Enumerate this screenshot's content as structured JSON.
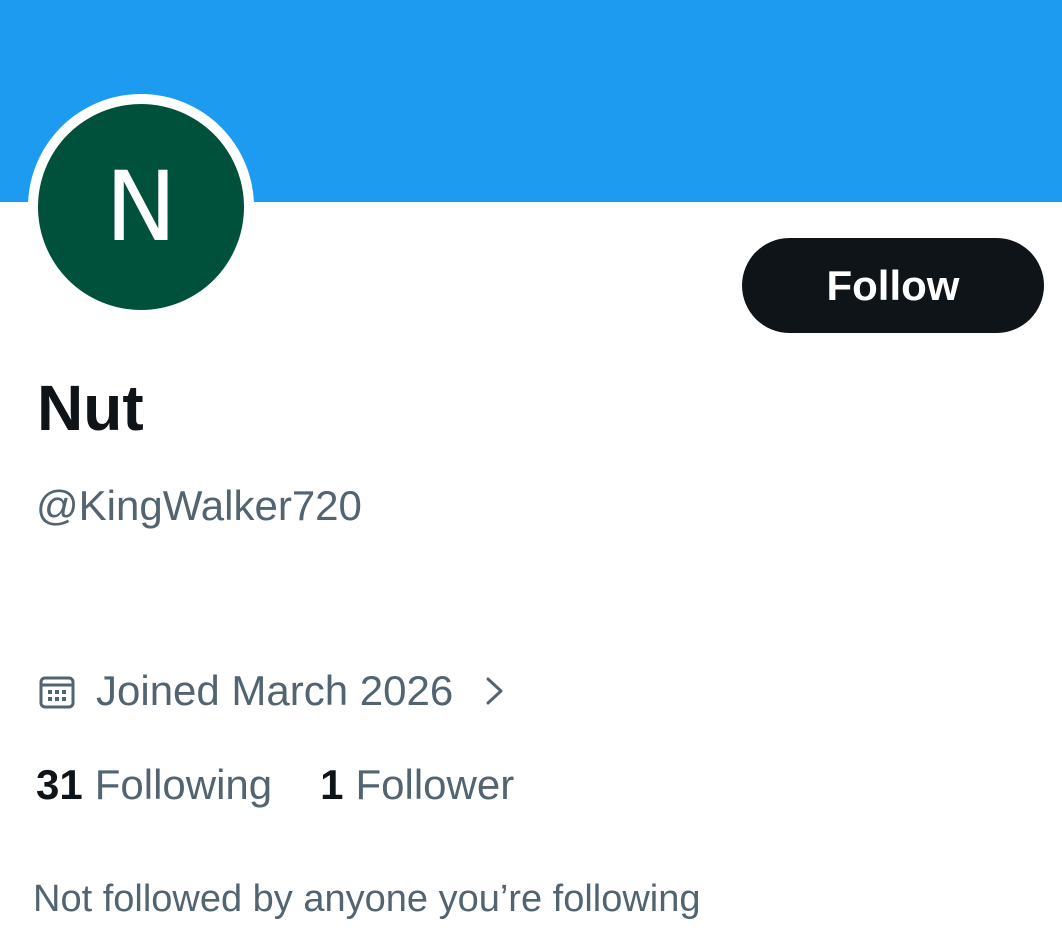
{
  "colors": {
    "banner": "#1d9bf0",
    "avatar_bg": "#00513b",
    "follow_bg": "#0f1419",
    "text_primary": "#0f1419",
    "text_secondary": "#536471"
  },
  "profile": {
    "avatar_initial": "N",
    "display_name": "Nut",
    "handle": "@KingWalker720",
    "joined": "Joined March 2026",
    "following_count": "31",
    "following_label": "Following",
    "followers_count": "1",
    "followers_label": "Follower",
    "mutual_text": "Not followed by anyone you’re following"
  },
  "actions": {
    "follow_label": "Follow"
  },
  "icons": {
    "joined": "calendar-icon",
    "joined_more": "chevron-right-icon"
  }
}
